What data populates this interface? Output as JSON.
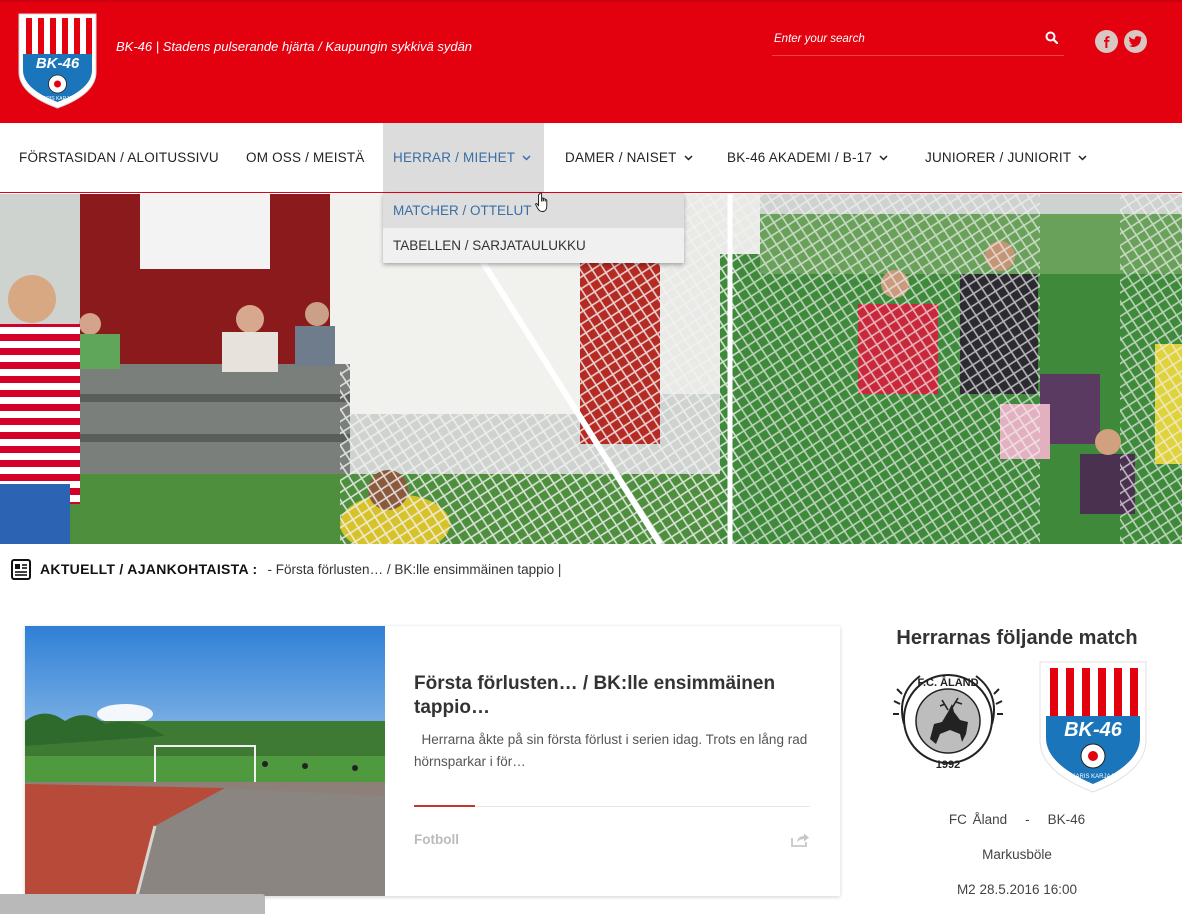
{
  "header": {
    "tagline": "BK-46 | Stadens pulserande hjärta / Kaupungin sykkivä sydän",
    "search_placeholder": "Enter your search",
    "brand_color": "#e3000f",
    "social": [
      "facebook-icon",
      "twitter-icon"
    ]
  },
  "nav": {
    "items": [
      {
        "label": "FÖRSTASIDAN / ALOITUSSIVU",
        "has_dropdown": false
      },
      {
        "label": "OM OSS / MEISTÄ",
        "has_dropdown": false
      },
      {
        "label": "HERRAR / MIEHET",
        "has_dropdown": true,
        "active": true
      },
      {
        "label": "DAMER / NAISET",
        "has_dropdown": true
      },
      {
        "label": "BK-46 AKADEMI / B-17",
        "has_dropdown": true
      },
      {
        "label": "JUNIORER / JUNIORIT",
        "has_dropdown": true
      }
    ],
    "dropdown": [
      "MATCHER / OTTELUT",
      "TABELLEN / SARJATAULUKKU"
    ]
  },
  "ticker": {
    "label": "AKTUELLT / AJANKOHTAISTA :",
    "text": "- Första förlusten… / BK:lle ensimmäinen tappio |"
  },
  "article": {
    "title": "Första förlusten… / BK:lle ensimmäinen tappio…",
    "excerpt": "Herrarna åkte på sin första förlust i serien idag. Trots en lång rad hörnsparkar i för…",
    "category": "Fotboll"
  },
  "match": {
    "heading": "Herrarnas följande match",
    "home": "FC Åland",
    "separator": "-",
    "away": "BK-46",
    "venue": "Markusböle",
    "date": "M2 28.5.2016 16:00"
  },
  "logo_text": {
    "bk46": "BK-46",
    "bk46_ribbon": "KARIS KARJAA",
    "fc_aland": "F.C. ÅLAND",
    "fc_aland_year": "1992"
  }
}
